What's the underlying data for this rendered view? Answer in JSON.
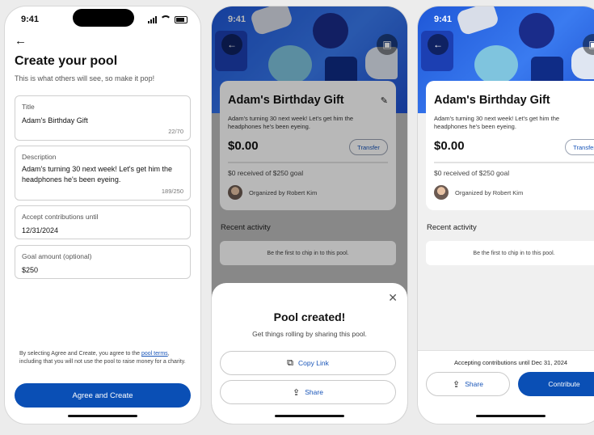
{
  "status": {
    "time": "9:41"
  },
  "create": {
    "title": "Create your pool",
    "subtitle": "This is what others will see, so make it pop!",
    "fields": [
      {
        "label": "Title",
        "value": "Adam's Birthday Gift",
        "counter": "22/70"
      },
      {
        "label": "Description",
        "value": "Adam's turning 30 next week! Let's get him the headphones he's been eyeing.",
        "counter": "189/250"
      },
      {
        "label": "Accept contributions until",
        "value": "12/31/2024"
      },
      {
        "label": "Goal amount (optional)",
        "value": "$250"
      }
    ],
    "legal_prefix": "By selecting Agree and Create, you agree to the ",
    "legal_link": "pool terms",
    "legal_suffix": ", including that you will not use the pool to raise money for a charity.",
    "primary_button": "Agree and Create"
  },
  "pool": {
    "name": "Adam's Birthday Gift",
    "description": "Adam's turning 30 next week! Let's get him the headphones he's been eyeing.",
    "amount": "$0.00",
    "transfer": "Transfer",
    "goal_text": "$0 received of $250 goal",
    "progress": 0,
    "organizer": "Organized by Robert Kim",
    "recent_title": "Recent activity",
    "empty_text": "Be the first to chip in to this pool."
  },
  "created_sheet": {
    "title": "Pool created!",
    "subtitle": "Get things rolling by sharing this pool.",
    "copy_link": "Copy Link",
    "share": "Share"
  },
  "bottom": {
    "accepting": "Accepting contributions until Dec 31, 2024",
    "share": "Share",
    "contribute": "Contribute"
  }
}
